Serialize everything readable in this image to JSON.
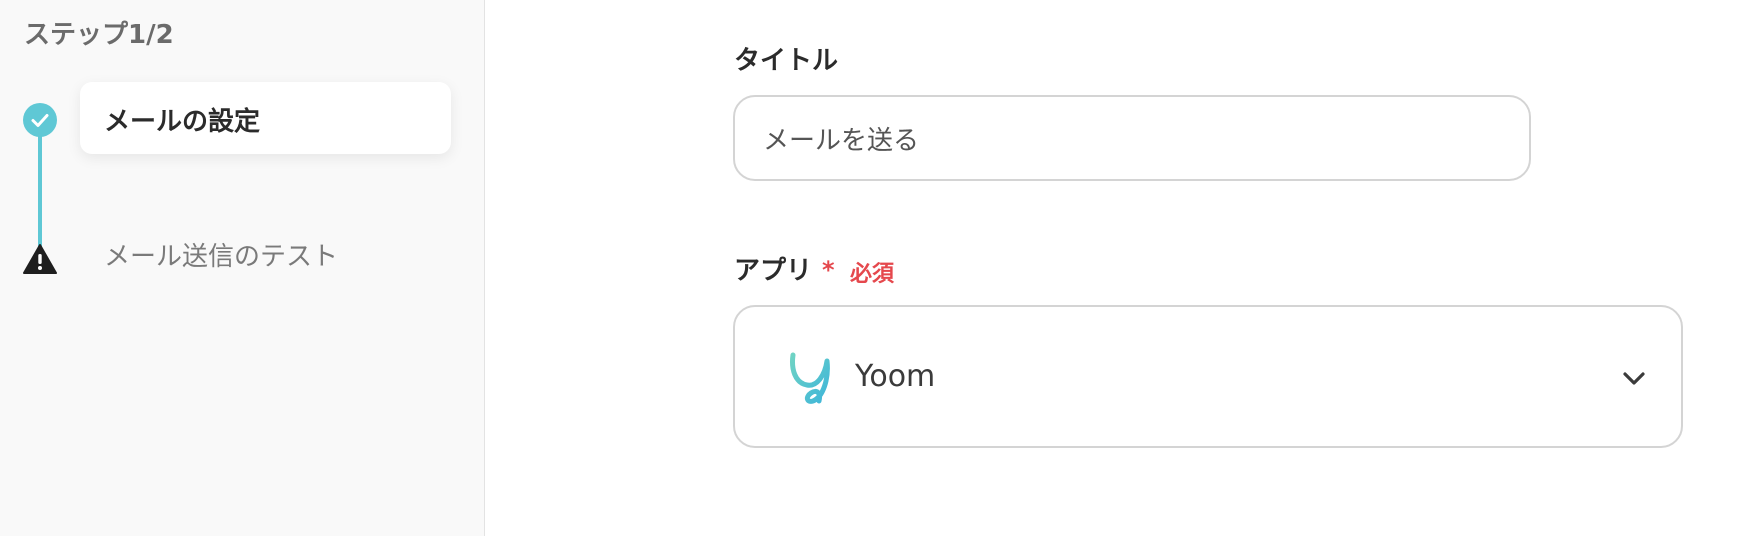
{
  "sidebar": {
    "step_counter": "ステップ1/2",
    "steps": [
      {
        "label": "メールの設定",
        "status": "completed",
        "icon": "check-icon"
      },
      {
        "label": "メール送信のテスト",
        "status": "warning",
        "icon": "warning-icon"
      }
    ]
  },
  "form": {
    "title_field": {
      "label": "タイトル",
      "value": "メールを送る"
    },
    "app_field": {
      "label": "アプリ",
      "required_mark": "*",
      "required_text": "必須",
      "selected_app": "Yoom",
      "app_icon": "yoom-logo-icon",
      "dropdown_icon": "chevron-down-icon"
    }
  },
  "colors": {
    "accent": "#5fc8d5",
    "required": "#e5484d",
    "warning": "#1f1f1f",
    "sidebar_bg": "#f9f9f9"
  }
}
